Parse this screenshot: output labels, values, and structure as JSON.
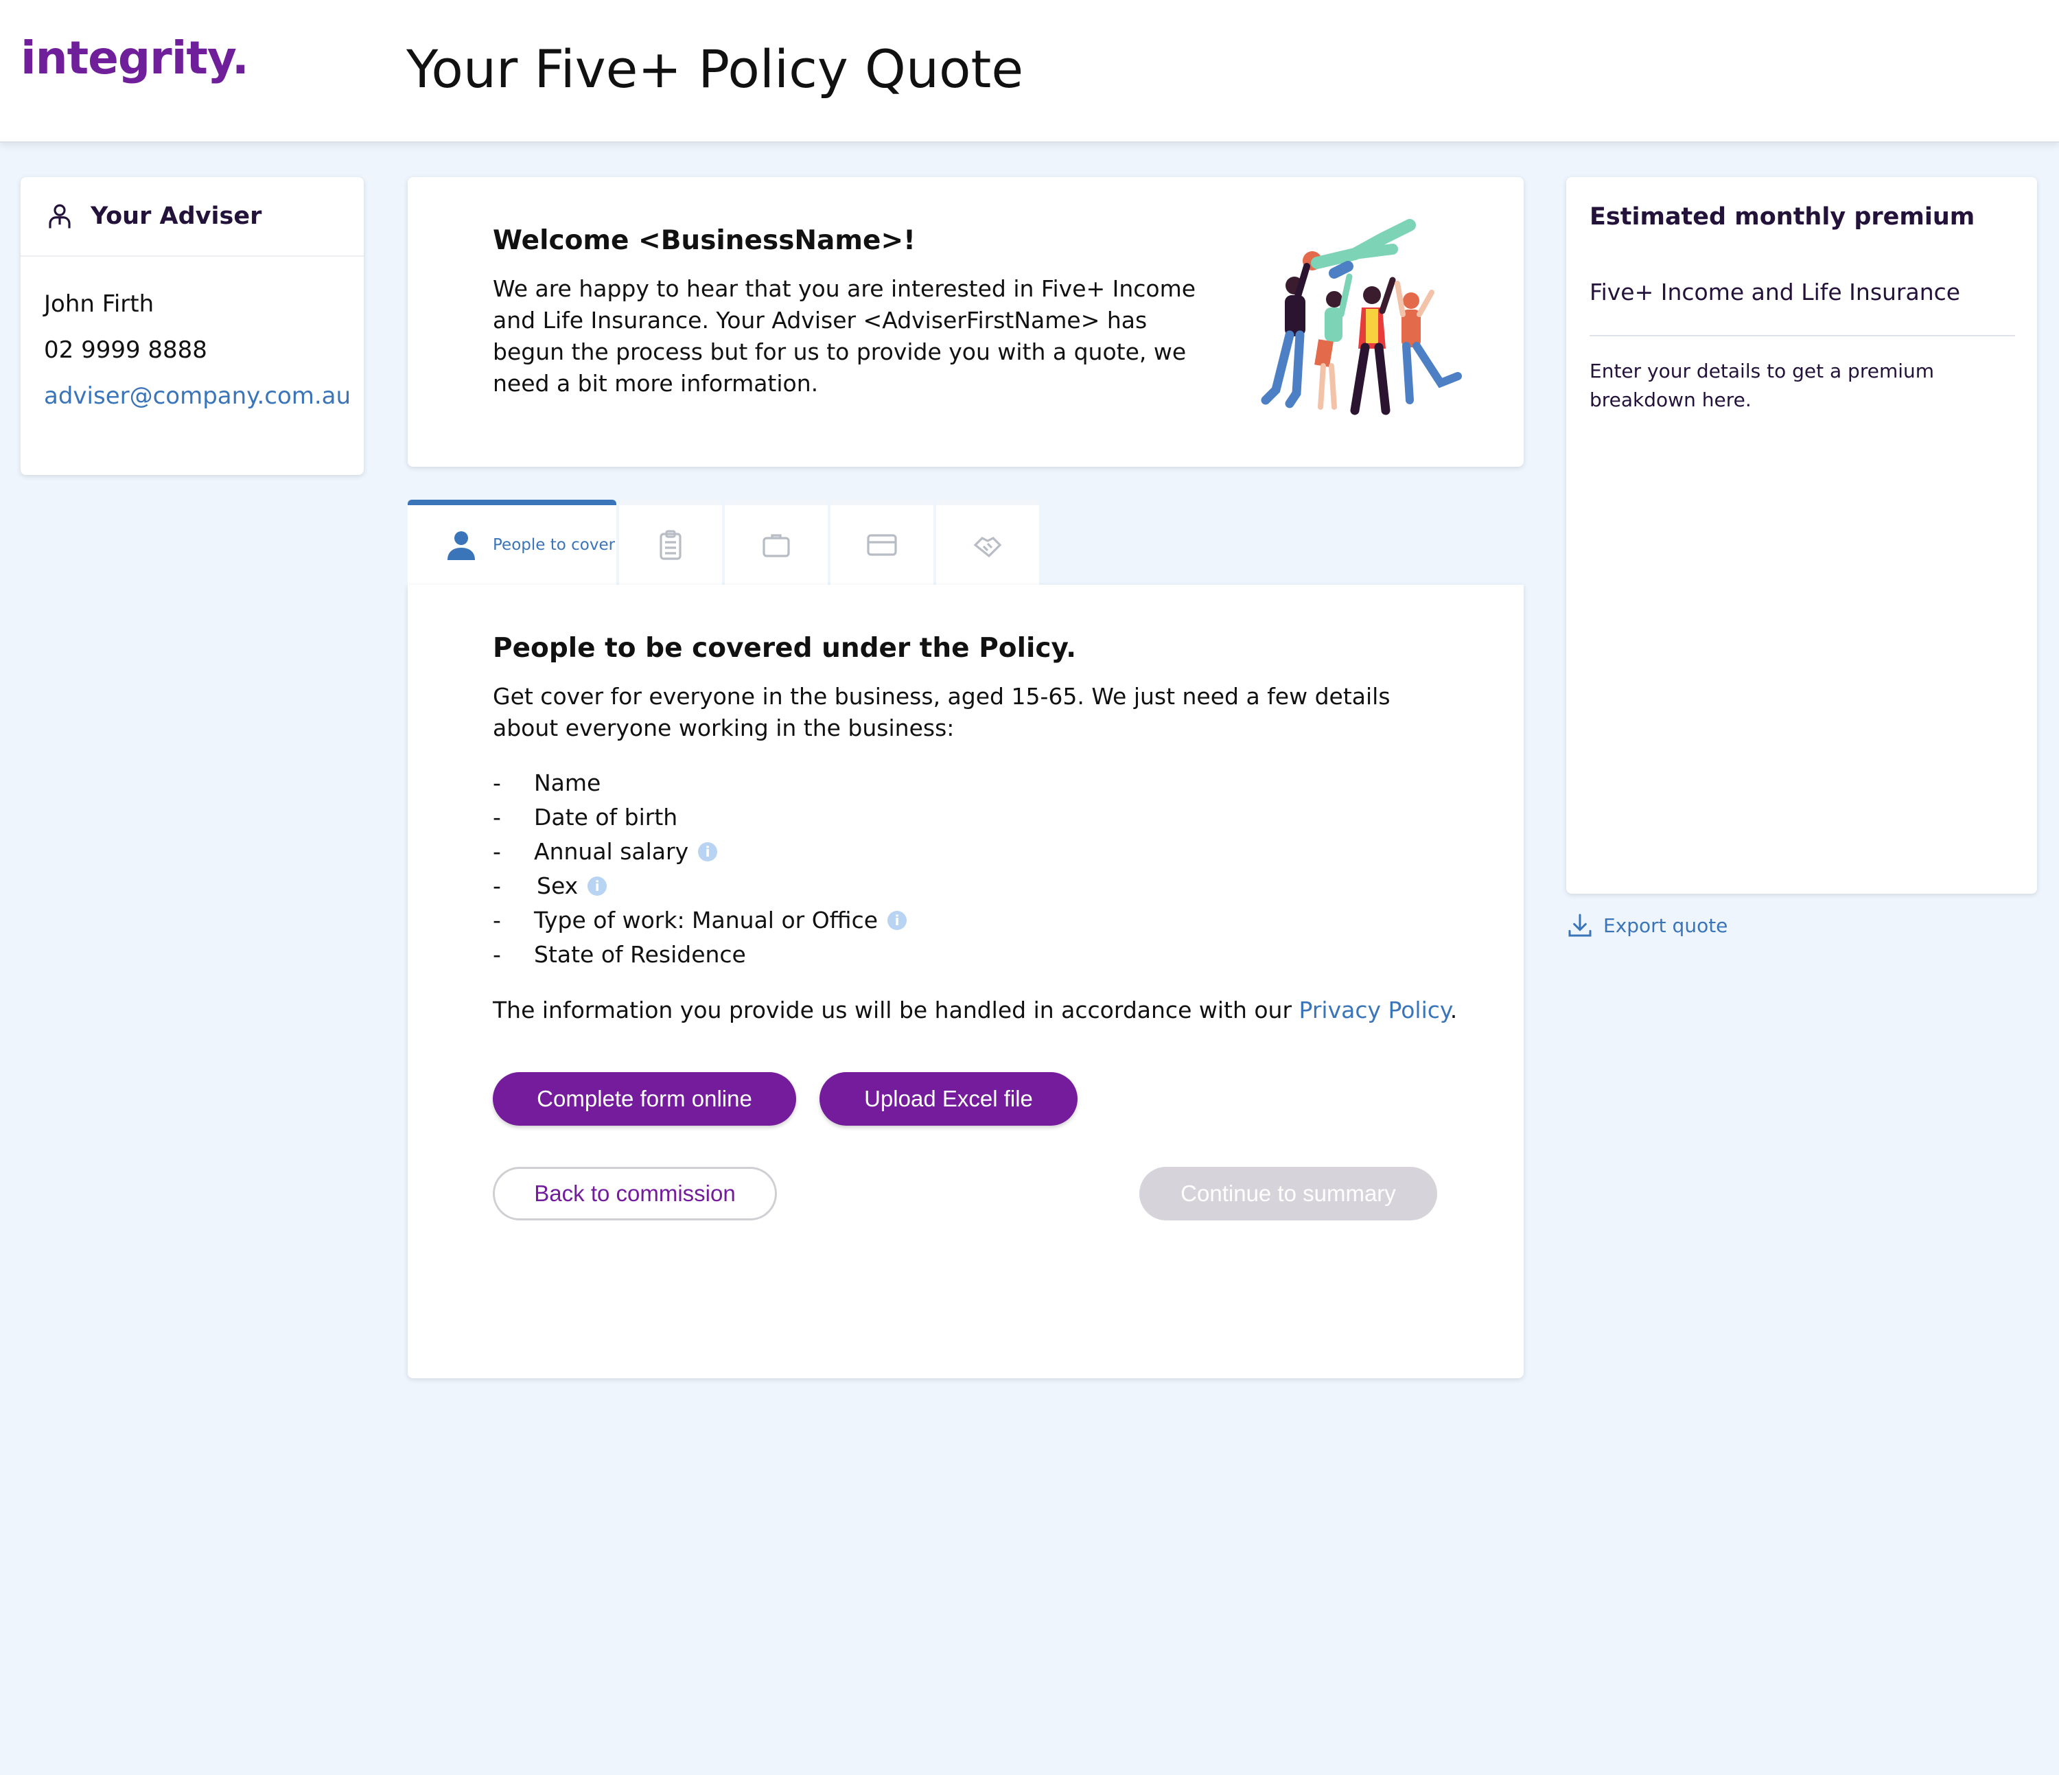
{
  "header": {
    "logo": "integrity.",
    "title": "Your Five+ Policy Quote"
  },
  "adviser": {
    "title": "Your Adviser",
    "name": "John Firth",
    "phone": "02 9999 8888",
    "email": "adviser@company.com.au",
    "icon": "adviser-icon"
  },
  "welcome": {
    "title": "Welcome <BusinessName>!",
    "text": "We are happy to hear that you are interested in Five+ Income and Life Insurance. Your Adviser <AdviserFirstName> has begun the process but for us to provide you with a quote, we need a bit more information."
  },
  "tabs": [
    {
      "label": "People to cover",
      "icon": "person-icon",
      "active": true
    },
    {
      "label": "",
      "icon": "clipboard-icon",
      "active": false
    },
    {
      "label": "",
      "icon": "briefcase-icon",
      "active": false
    },
    {
      "label": "",
      "icon": "credit-card-icon",
      "active": false
    },
    {
      "label": "",
      "icon": "handshake-icon",
      "active": false
    }
  ],
  "main": {
    "title": "People to be covered under the Policy.",
    "intro": "Get cover for everyone in the business, aged 15-65. We just need a few details about everyone working in the business:",
    "requirements": [
      {
        "dash": "-",
        "label": "Name",
        "info": false
      },
      {
        "dash": "-",
        "label": "Date of birth",
        "info": false
      },
      {
        "dash": "-",
        "label": "Annual salary",
        "info": true
      },
      {
        "dash": "-",
        "label": "Sex",
        "info": true
      },
      {
        "dash": "-",
        "label": "Type of work: Manual or Office",
        "info": true
      },
      {
        "dash": "-",
        "label": "State of Residence",
        "info": false
      }
    ],
    "privacy_prefix": "The information you provide us will be handled in accordance with our ",
    "privacy_link": "Privacy Policy",
    "privacy_suffix": ".",
    "buttons": {
      "complete": "Complete form online",
      "upload": "Upload Excel file",
      "back": "Back to commission",
      "continue": "Continue to summary"
    }
  },
  "premium": {
    "title": "Estimated monthly premium",
    "product": "Five+ Income and Life Insurance",
    "note": "Enter your details to get a premium breakdown here."
  },
  "export": {
    "label": "Export quote",
    "icon": "download-icon"
  },
  "colors": {
    "brand_purple": "#741c9c",
    "link_blue": "#3a74b9",
    "page_bg": "#eef5fd",
    "disabled_button": "#d6d3da"
  }
}
